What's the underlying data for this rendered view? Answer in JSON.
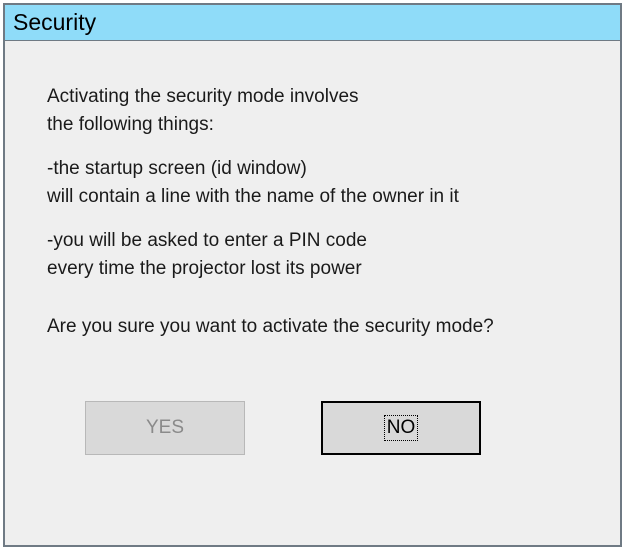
{
  "dialog": {
    "title": "Security",
    "paragraphs": [
      [
        "Activating the security mode involves",
        "the following things:"
      ],
      [
        "-the startup screen (id window)",
        "will contain a line with the name of the owner in it"
      ],
      [
        "-you will be asked to enter a PIN code",
        "every time the projector lost its power"
      ]
    ],
    "question": "Are you sure you want to activate the security mode?",
    "buttons": {
      "yes_label": "YES",
      "no_label": "NO"
    }
  },
  "colors": {
    "titlebar": "#8fdcf9",
    "background": "#efefef",
    "button_face": "#d9d9d9",
    "disabled_text": "#8a8a8a"
  }
}
